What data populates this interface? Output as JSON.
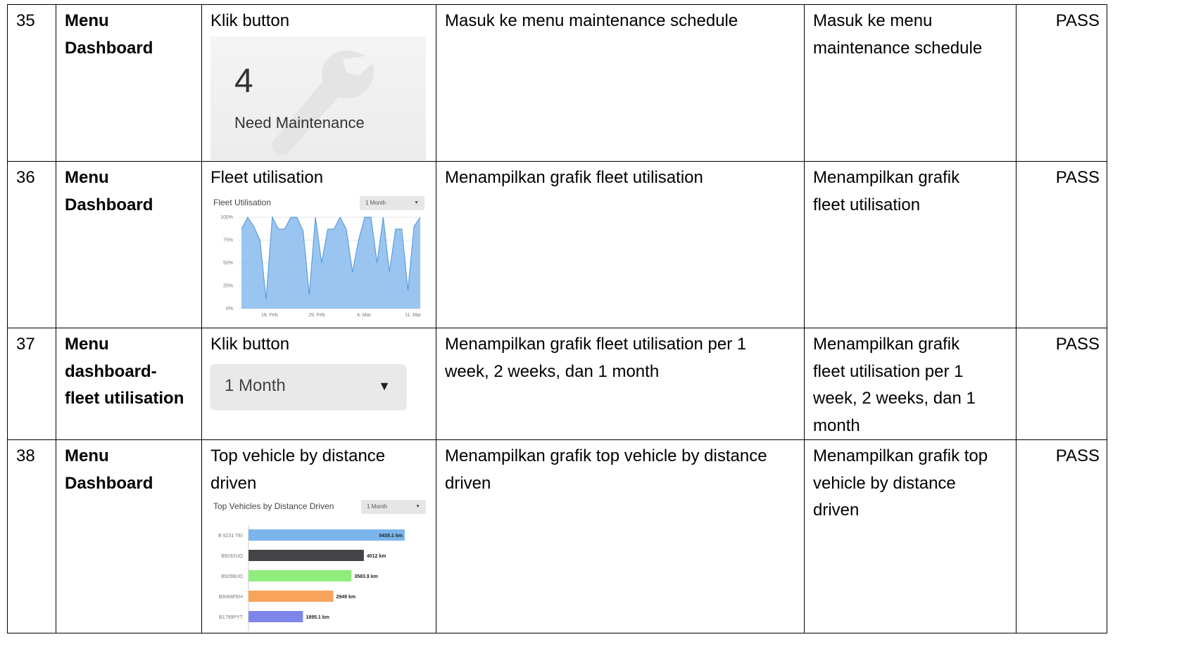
{
  "rows": [
    {
      "no": "35",
      "scenario_line1": "Menu",
      "scenario_line2": "Dashboard",
      "step": "Klik button",
      "expected": "Masuk ke menu maintenance schedule",
      "actual_line1": "Masuk ke menu",
      "actual_line2": "maintenance schedule",
      "result": "PASS",
      "card": {
        "number": "4",
        "caption": "Need Maintenance",
        "icon": "wrench-icon"
      }
    },
    {
      "no": "36",
      "scenario_line1": "Menu",
      "scenario_line2": "Dashboard",
      "step": "Fleet utilisation",
      "expected": "Menampilkan grafik fleet utilisation",
      "actual_line1": "Menampilkan grafik",
      "actual_line2": "fleet utilisation",
      "result": "PASS",
      "chart_title": "Fleet Utilisation",
      "select_value": "1 Month"
    },
    {
      "no": "37",
      "scenario_line1": "Menu",
      "scenario_line2": "dashboard-",
      "scenario_line3": "fleet utilisation",
      "step": "Klik button",
      "expected_line1": "Menampilkan grafik fleet utilisation per 1",
      "expected_line2": "week, 2 weeks, dan 1 month",
      "actual_line1": "Menampilkan grafik",
      "actual_line2": "fleet utilisation per 1",
      "actual_line3": "week, 2 weeks, dan 1",
      "actual_line4": "month",
      "result": "PASS",
      "dropdown_value": "1 Month"
    },
    {
      "no": "38",
      "scenario_line1": "Menu",
      "scenario_line2": "Dashboard",
      "step_line1": "Top vehicle by distance",
      "step_line2": "driven",
      "expected_line1": "Menampilkan grafik top vehicle by distance",
      "expected_line2": "driven",
      "actual_line1": "Menampilkan grafik top",
      "actual_line2": "vehicle by distance",
      "actual_line3": "driven",
      "result": "PASS",
      "chart_title": "Top Vehicles by Distance Driven",
      "select_value": "1 Month"
    }
  ],
  "chart_data": [
    {
      "type": "area",
      "title": "Fleet Utilisation",
      "x_tick_labels": [
        "18. Feb",
        "25. Feb",
        "4. Mar",
        "11. Mar"
      ],
      "y_tick_labels": [
        "100%",
        "75%",
        "50%",
        "25%",
        "0%"
      ],
      "ylim": [
        0,
        100
      ],
      "grid": true,
      "color": "#8fbfee",
      "series": [
        {
          "values": [
            87,
            100,
            90,
            75,
            10,
            100,
            87,
            87,
            100,
            100,
            85,
            15,
            100,
            50,
            87,
            87,
            100,
            87,
            40,
            75,
            100,
            100,
            50,
            100,
            40,
            87,
            87,
            20,
            90,
            100
          ]
        }
      ]
    },
    {
      "type": "bar",
      "orientation": "horizontal",
      "title": "Top Vehicles by Distance Driven",
      "categories": [
        "B 9231 TEI",
        "B9292UO",
        "B9298UO",
        "B9068FEH",
        "B1799PYT"
      ],
      "values": [
        5435.1,
        4012,
        3583.9,
        2949,
        1895.1
      ],
      "value_labels": [
        "5435.1 km",
        "4012 km",
        "3583.9 km",
        "2949 km",
        "1895.1 km"
      ],
      "colors": [
        "#7cb5ec",
        "#434348",
        "#90ed7d",
        "#f7a35c",
        "#8085e9"
      ]
    }
  ]
}
